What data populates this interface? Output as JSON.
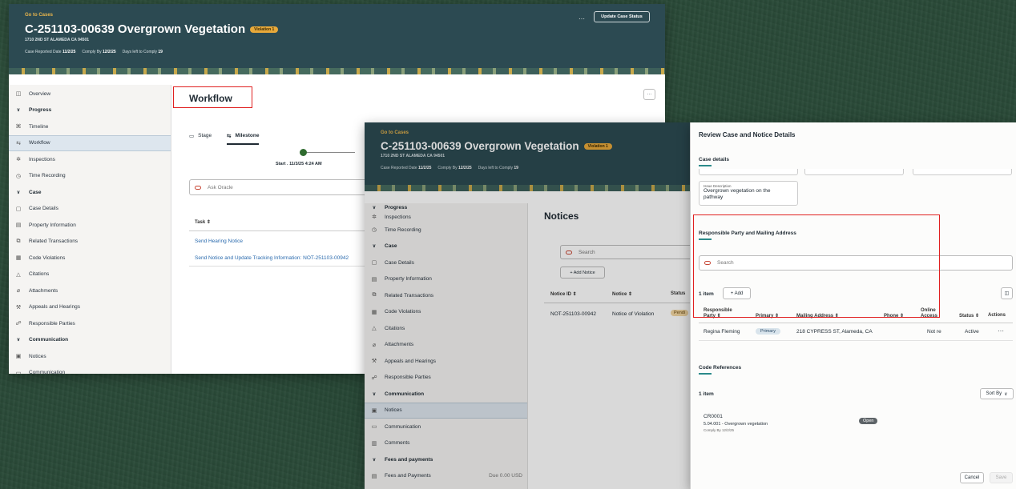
{
  "case": {
    "go_to": "Go to Cases",
    "title": "C-251103-00639 Overgrown Vegetation",
    "violation_badge": "Violation 1",
    "address": "1710 2ND ST ALAMEDA CA 94501",
    "reported_label": "Case Reported Date",
    "reported_value": "11/2/25",
    "comply_label": "Comply By",
    "comply_value": "12/2/25",
    "days_label": "Days left to Comply",
    "days_value": "19",
    "update_status": "Update Case Status",
    "more": "···"
  },
  "nav": {
    "overview": "Overview",
    "progress": "Progress",
    "timeline": "Timeline",
    "workflow": "Workflow",
    "inspections": "Inspections",
    "time_recording": "Time Recording",
    "case": "Case",
    "case_details": "Case Details",
    "property_information": "Property Information",
    "related_transactions": "Related Transactions",
    "code_violations": "Code Violations",
    "citations": "Citations",
    "attachments": "Attachments",
    "appeals": "Appeals and Hearings",
    "responsible_parties": "Responsible Parties",
    "communication": "Communication",
    "notices": "Notices",
    "communication_item": "Communication",
    "comments": "Comments",
    "fees": "Fees and payments",
    "fees_item": "Fees and Payments",
    "fees_due": "Due 0.00 USD"
  },
  "workflow": {
    "heading": "Workflow",
    "tab_stage": "Stage",
    "tab_milestone": "Milestone",
    "start_label": "Start . 11/3/25 4:24 AM",
    "ask_oracle": "Ask Oracle",
    "task_header": "Task",
    "tasks": [
      "Send Hearing Notice",
      "Send Notice and Update Tracking Information: NOT-251103-00942"
    ]
  },
  "notices": {
    "heading": "Notices",
    "search": "Search",
    "add": "+ Add Notice",
    "col_id": "Notice ID",
    "col_notice": "Notice",
    "col_status": "Status",
    "row_id": "NOT-251103-00942",
    "row_notice": "Notice of Violation",
    "row_status": "Pendi"
  },
  "review": {
    "title": "Review Case and Notice Details",
    "case_details": "Case details",
    "issue_label": "Issue Description",
    "issue_value": "Overgrown vegetation on the pathway",
    "rp_heading": "Responsible Party and Mailing Address",
    "search": "Search",
    "count": "1 item",
    "add": "+ Add",
    "col_party": "Responsible Party",
    "col_primary": "Primary",
    "col_mailing": "Mailing Address",
    "col_phone": "Phone",
    "col_online": "Online Access",
    "col_status": "Status",
    "col_actions": "Actions",
    "row_party": "Regina Fleming",
    "row_primary": "Primary",
    "row_mailing": "218 CYPRESS ST, Alameda, CA",
    "row_online": "Not re",
    "row_status": "Active",
    "code_refs": "Code References",
    "code_count": "1 item",
    "sort_by": "Sort By",
    "code_id": "CR0001",
    "code_desc": "5.04.001 - Overgrown vegetation",
    "code_comply": "Comply By 12/2/25",
    "code_status": "Open",
    "cancel": "Cancel",
    "save": "Save"
  }
}
